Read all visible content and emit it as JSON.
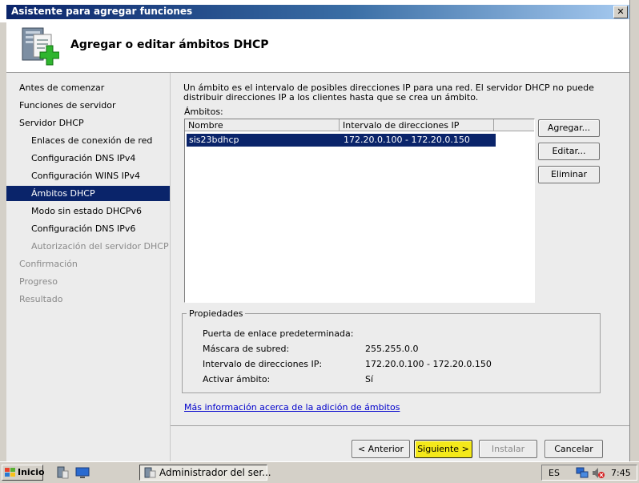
{
  "window": {
    "title": "Asistente para agregar funciones",
    "close_glyph": "✕",
    "header_title": "Agregar o editar ámbitos DHCP",
    "header_icon": "server-add-icon"
  },
  "nav": {
    "items": [
      {
        "label": "Antes de comenzar",
        "level": 0,
        "state": "normal"
      },
      {
        "label": "Funciones de servidor",
        "level": 0,
        "state": "normal"
      },
      {
        "label": "Servidor DHCP",
        "level": 0,
        "state": "normal"
      },
      {
        "label": "Enlaces de conexión de red",
        "level": 1,
        "state": "normal"
      },
      {
        "label": "Configuración DNS IPv4",
        "level": 1,
        "state": "normal"
      },
      {
        "label": "Configuración WINS IPv4",
        "level": 1,
        "state": "normal"
      },
      {
        "label": "Ámbitos DHCP",
        "level": 1,
        "state": "selected"
      },
      {
        "label": "Modo sin estado DHCPv6",
        "level": 1,
        "state": "normal"
      },
      {
        "label": "Configuración DNS IPv6",
        "level": 1,
        "state": "normal"
      },
      {
        "label": "Autorización del servidor DHCP",
        "level": 1,
        "state": "disabled"
      },
      {
        "label": "Confirmación",
        "level": 0,
        "state": "disabled"
      },
      {
        "label": "Progreso",
        "level": 0,
        "state": "disabled"
      },
      {
        "label": "Resultado",
        "level": 0,
        "state": "disabled"
      }
    ]
  },
  "main": {
    "description": "Un ámbito es el intervalo de posibles direcciones IP para una red. El servidor DHCP no puede distribuir direcciones IP a los clientes hasta que se crea un ámbito.",
    "scopes_label": "Ámbitos:",
    "columns": [
      "Nombre",
      "Intervalo de direcciones IP"
    ],
    "rows": [
      {
        "name": "sis23bdhcp",
        "range": "172.20.0.100 - 172.20.0.150"
      }
    ],
    "buttons": {
      "add": "Agregar...",
      "edit": "Editar...",
      "delete": "Eliminar"
    },
    "properties": {
      "title": "Propiedades",
      "gateway_label": "Puerta de enlace predeterminada:",
      "gateway_value": "",
      "mask_label": "Máscara de subred:",
      "mask_value": "255.255.0.0",
      "range_label": "Intervalo de direcciones IP:",
      "range_value": "172.20.0.100 - 172.20.0.150",
      "activate_label": "Activar ámbito:",
      "activate_value": "Sí"
    },
    "link": "Más información acerca de la adición de ámbitos"
  },
  "footer": {
    "back": "< Anterior",
    "next": "Siguiente >",
    "install": "Instalar",
    "cancel": "Cancelar"
  },
  "taskbar": {
    "start": "Inicio",
    "task": "Administrador del ser...",
    "lang": "ES",
    "time": "7:45"
  },
  "colors": {
    "selection": "#0a246a",
    "default_button": "#f4e91a",
    "link": "#0000cc"
  }
}
